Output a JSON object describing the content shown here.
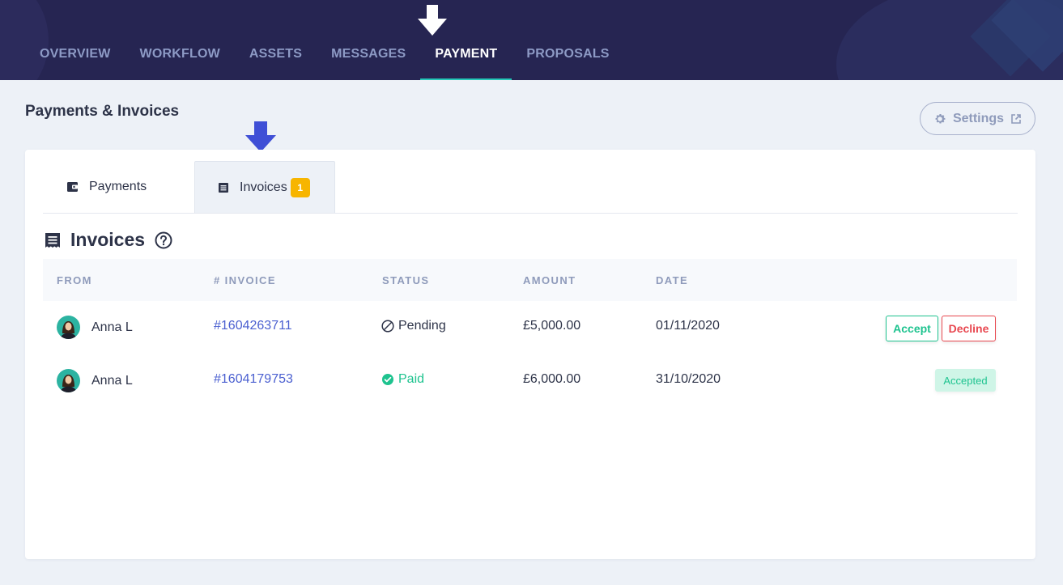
{
  "nav": {
    "items": [
      {
        "label": "OVERVIEW"
      },
      {
        "label": "WORKFLOW"
      },
      {
        "label": "ASSETS"
      },
      {
        "label": "MESSAGES"
      },
      {
        "label": "PAYMENT",
        "active": true
      },
      {
        "label": "PROPOSALS"
      }
    ]
  },
  "page": {
    "title": "Payments & Invoices",
    "settings_label": "Settings"
  },
  "tabs": {
    "payments_label": "Payments",
    "invoices_label": "Invoices",
    "invoices_count": "1"
  },
  "section": {
    "title": "Invoices"
  },
  "table": {
    "headers": [
      "FROM",
      "# INVOICE",
      "STATUS",
      "AMOUNT",
      "DATE"
    ],
    "rows": [
      {
        "from": "Anna L",
        "invoice": "#1604263711",
        "status": "Pending",
        "amount": "£5,000.00",
        "date": "01/11/2020",
        "accept_label": "Accept",
        "decline_label": "Decline"
      },
      {
        "from": "Anna L",
        "invoice": "#1604179753",
        "status": "Paid",
        "amount": "£6,000.00",
        "date": "31/10/2020",
        "badge": "Accepted"
      }
    ]
  },
  "colors": {
    "header_bg": "#262552",
    "accent_teal": "#24c7b8",
    "link_blue": "#4a5fd0",
    "success_green": "#1ec38f",
    "danger_red": "#e8474f",
    "badge_yellow": "#f7b500"
  },
  "icons": {
    "nav_pointer": "arrow-down-icon",
    "tab_pointer": "arrow-down-icon",
    "settings": "gear-icon",
    "external": "external-link-icon",
    "payments_tab": "wallet-icon",
    "invoices_tab": "document-icon",
    "section": "receipt-icon",
    "help": "help-circle-icon",
    "pending": "ban-icon",
    "paid": "check-circle-icon"
  }
}
